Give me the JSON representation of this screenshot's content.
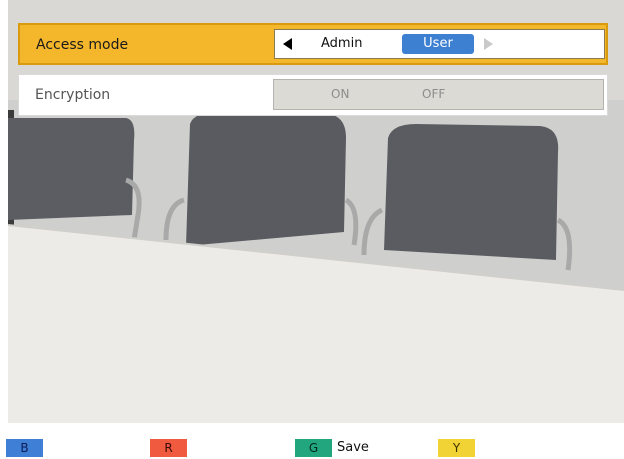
{
  "settings": {
    "access_mode": {
      "label": "Access mode",
      "options": [
        "Admin",
        "User"
      ],
      "selected": "User"
    },
    "encryption": {
      "label": "Encryption",
      "options": [
        "ON",
        "OFF"
      ]
    }
  },
  "color_keys": {
    "blue": "B",
    "red": "R",
    "green": "G",
    "green_action": "Save",
    "yellow": "Y"
  },
  "colors": {
    "highlight": "#f4b62b",
    "selected_option": "#3d7fd1",
    "blue_key": "#3f7fd6",
    "red_key": "#f05a3f",
    "green_key": "#22a67d",
    "yellow_key": "#f2d335"
  }
}
